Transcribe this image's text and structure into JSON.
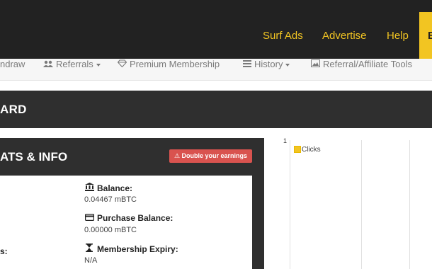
{
  "topnav": {
    "items": [
      "Surf Ads",
      "Advertise",
      "Help"
    ],
    "cut_item": "E"
  },
  "subnav": {
    "items": [
      {
        "label": "ndraw",
        "icon": "",
        "caret": false
      },
      {
        "label": "Referrals",
        "icon": "users-icon",
        "caret": true
      },
      {
        "label": "Premium Membership",
        "icon": "diamond-icon",
        "caret": false
      },
      {
        "label": "History",
        "icon": "list-icon",
        "caret": true
      },
      {
        "label": "Referral/Affiliate Tools",
        "icon": "image-icon",
        "caret": false
      }
    ]
  },
  "dashboard": {
    "title": "ARD"
  },
  "stats": {
    "title": "ATS & INFO",
    "double_button": "Double your earnings",
    "cut_label": "s:",
    "items": [
      {
        "label": "Balance:",
        "value": "0.04467 mBTC",
        "icon": "bank-icon"
      },
      {
        "label": "Purchase Balance:",
        "value": "0.00000 mBTC",
        "icon": "card-icon"
      },
      {
        "label": "Membership Expiry:",
        "value": "N/A",
        "icon": "hourglass-icon"
      }
    ]
  },
  "chart_data": {
    "type": "line",
    "series": [
      {
        "name": "Clicks",
        "values": []
      }
    ],
    "y_tick_labels": [
      "1"
    ],
    "colors": {
      "Clicks": "#f2c522"
    }
  }
}
